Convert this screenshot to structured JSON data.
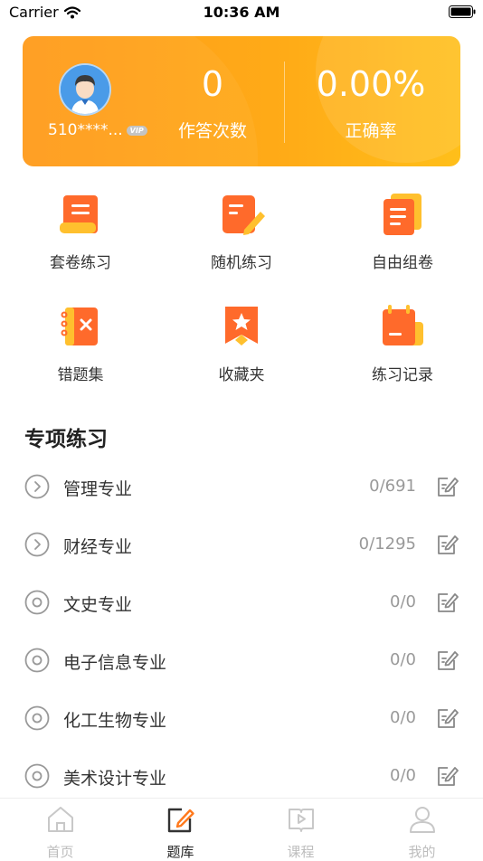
{
  "status_bar": {
    "carrier": "Carrier",
    "time": "10:36 AM"
  },
  "header": {
    "user_id": "510****...",
    "vip_badge": "VIP",
    "answer_count": "0",
    "answer_count_label": "作答次数",
    "accuracy": "0.00%",
    "accuracy_label": "正确率"
  },
  "grid": [
    {
      "label": "套卷练习",
      "icon": "scroll-paper-icon"
    },
    {
      "label": "随机练习",
      "icon": "edit-note-icon"
    },
    {
      "label": "自由组卷",
      "icon": "stacked-papers-icon"
    },
    {
      "label": "错题集",
      "icon": "wrong-notebook-icon"
    },
    {
      "label": "收藏夹",
      "icon": "star-bookmark-icon"
    },
    {
      "label": "练习记录",
      "icon": "record-calendar-icon"
    }
  ],
  "section_title": "专项练习",
  "subjects": [
    {
      "name": "管理专业",
      "count": "0/691",
      "state": "expandable"
    },
    {
      "name": "财经专业",
      "count": "0/1295",
      "state": "expandable"
    },
    {
      "name": "文史专业",
      "count": "0/0",
      "state": "leaf"
    },
    {
      "name": "电子信息专业",
      "count": "0/0",
      "state": "leaf"
    },
    {
      "name": "化工生物专业",
      "count": "0/0",
      "state": "leaf"
    },
    {
      "name": "美术设计专业",
      "count": "0/0",
      "state": "leaf"
    }
  ],
  "tabs": [
    {
      "label": "首页",
      "icon": "home-icon",
      "active": false
    },
    {
      "label": "题库",
      "icon": "question-bank-icon",
      "active": true
    },
    {
      "label": "课程",
      "icon": "course-play-icon",
      "active": false
    },
    {
      "label": "我的",
      "icon": "profile-icon",
      "active": false
    }
  ],
  "colors": {
    "accent": "#FF8A1E",
    "brand_orange": "#FFA41A",
    "muted": "#999999"
  }
}
